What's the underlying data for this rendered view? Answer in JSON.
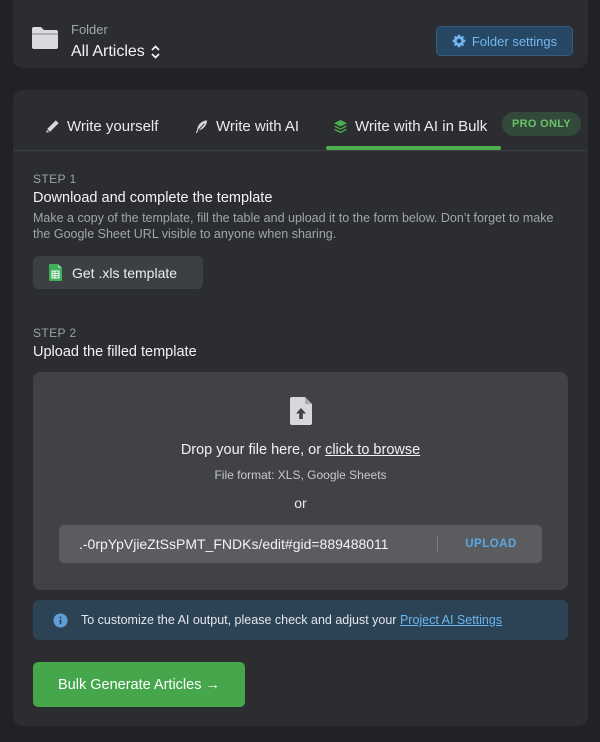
{
  "folder": {
    "label": "Folder",
    "value": "All Articles",
    "settings_label": "Folder settings",
    "icon": "folder-icon"
  },
  "tabs": [
    {
      "label": "Write yourself",
      "icon": "pen-icon"
    },
    {
      "label": "Write with AI",
      "icon": "feather-icon"
    },
    {
      "label": "Write with AI in Bulk",
      "icon": "layers-icon",
      "active": true
    }
  ],
  "pro_badge": "PRO ONLY",
  "step1": {
    "label": "STEP 1",
    "title": "Download and complete the template",
    "description": "Make a copy of the template, fill the table and upload it to the form below. Don’t forget to make the Google Sheet URL visible to anyone when sharing.",
    "button_label": "Get .xls template"
  },
  "step2": {
    "label": "STEP 2",
    "title": "Upload the filled template"
  },
  "dropzone": {
    "drop_text": "Drop your file here, or ",
    "browse_link": "click to browse",
    "format": "File format: XLS, Google Sheets",
    "or": "or",
    "url_value": ".-0rpYpVjieZtSsPMT_FNDKs/edit#gid=889488011",
    "upload_label": "UPLOAD"
  },
  "info": {
    "text": "To customize the AI output, please check and adjust your ",
    "link": "Project AI Settings"
  },
  "generate_label": "Bulk Generate Articles →",
  "colors": {
    "background": "#202226",
    "panel": "#2b2d31",
    "accent_green": "#46a64b",
    "accent_blue": "#58a9e4",
    "info_bg": "#2c4356"
  }
}
